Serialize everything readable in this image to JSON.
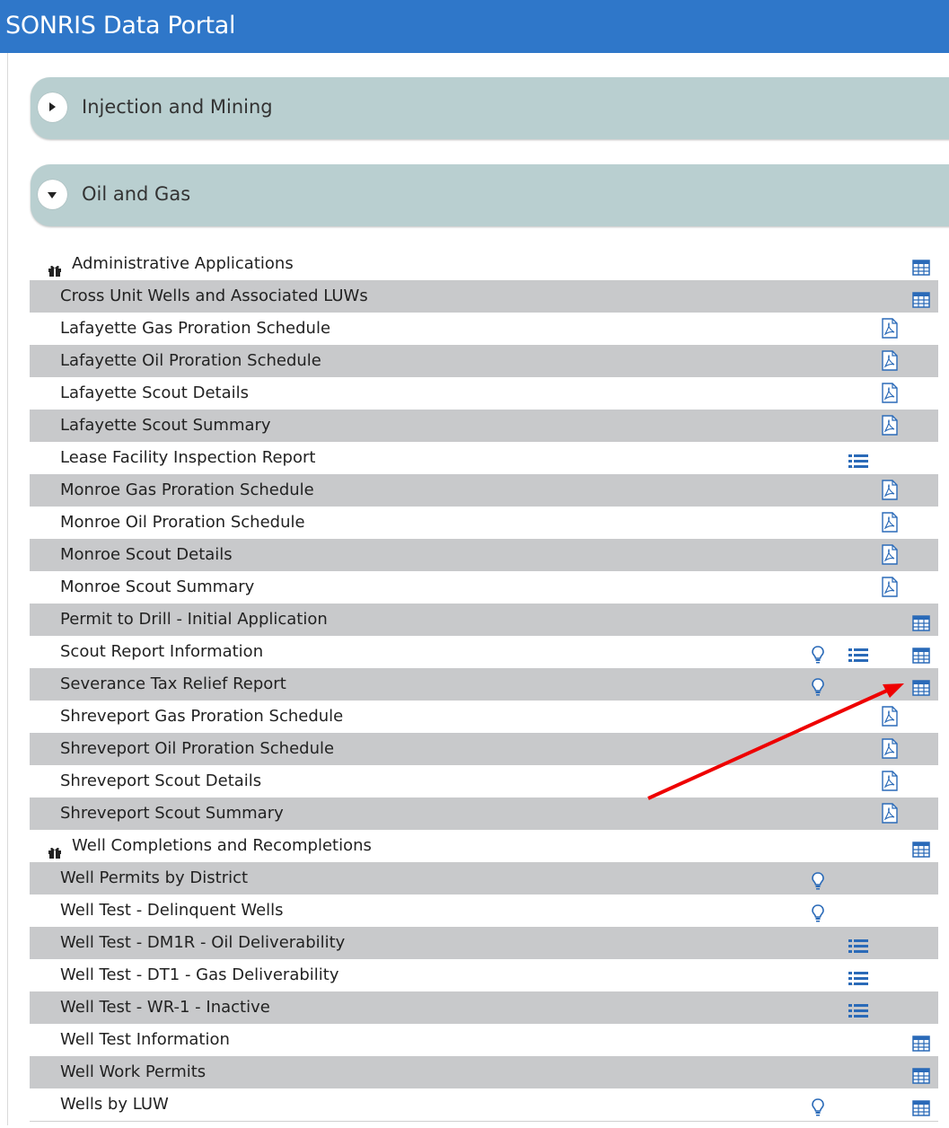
{
  "header": {
    "title": "SONRIS Data Portal"
  },
  "sections": [
    {
      "title": "Injection and Mining",
      "expanded": false
    },
    {
      "title": "Oil and Gas",
      "expanded": true
    }
  ],
  "rows": [
    {
      "label": "Administrative Applications",
      "gift": true,
      "icons": [
        "grid"
      ]
    },
    {
      "label": "Cross Unit Wells and Associated LUWs",
      "icons": [
        "grid"
      ]
    },
    {
      "label": "Lafayette Gas Proration Schedule",
      "icons": [
        "pdf"
      ]
    },
    {
      "label": "Lafayette Oil Proration Schedule",
      "icons": [
        "pdf"
      ]
    },
    {
      "label": "Lafayette Scout Details",
      "icons": [
        "pdf"
      ]
    },
    {
      "label": "Lafayette Scout Summary",
      "icons": [
        "pdf"
      ]
    },
    {
      "label": "Lease Facility Inspection Report",
      "icons": [
        "list"
      ]
    },
    {
      "label": "Monroe Gas Proration Schedule",
      "icons": [
        "pdf"
      ]
    },
    {
      "label": "Monroe Oil Proration Schedule",
      "icons": [
        "pdf"
      ]
    },
    {
      "label": "Monroe Scout Details",
      "icons": [
        "pdf"
      ]
    },
    {
      "label": "Monroe Scout Summary",
      "icons": [
        "pdf"
      ]
    },
    {
      "label": "Permit to Drill - Initial Application",
      "icons": [
        "grid"
      ]
    },
    {
      "label": "Scout Report Information",
      "icons": [
        "bulb",
        "list",
        "grid"
      ]
    },
    {
      "label": "Severance Tax Relief Report",
      "icons": [
        "bulb",
        "grid"
      ]
    },
    {
      "label": "Shreveport Gas Proration Schedule",
      "icons": [
        "pdf"
      ]
    },
    {
      "label": "Shreveport Oil Proration Schedule",
      "icons": [
        "pdf"
      ]
    },
    {
      "label": "Shreveport Scout Details",
      "icons": [
        "pdf"
      ]
    },
    {
      "label": "Shreveport Scout Summary",
      "icons": [
        "pdf"
      ]
    },
    {
      "label": "Well Completions and Recompletions",
      "gift": true,
      "icons": [
        "grid"
      ]
    },
    {
      "label": "Well Permits by District",
      "icons": [
        "bulb"
      ]
    },
    {
      "label": "Well Test - Delinquent Wells",
      "icons": [
        "bulb"
      ]
    },
    {
      "label": "Well Test - DM1R - Oil Deliverability",
      "icons": [
        "list"
      ]
    },
    {
      "label": "Well Test - DT1 - Gas Deliverability",
      "icons": [
        "list"
      ]
    },
    {
      "label": "Well Test - WR-1 - Inactive",
      "icons": [
        "list"
      ]
    },
    {
      "label": "Well Test Information",
      "icons": [
        "grid"
      ]
    },
    {
      "label": "Well Work Permits",
      "icons": [
        "grid"
      ]
    },
    {
      "label": "Wells by LUW",
      "icons": [
        "bulb",
        "grid"
      ]
    }
  ],
  "colors": {
    "header": "#2f77c9",
    "panel": "#b9cfd0",
    "row_alt": "#c8c9cb",
    "icon_blue": "#2a6ab8",
    "annotation_arrow": "#ee0000"
  }
}
